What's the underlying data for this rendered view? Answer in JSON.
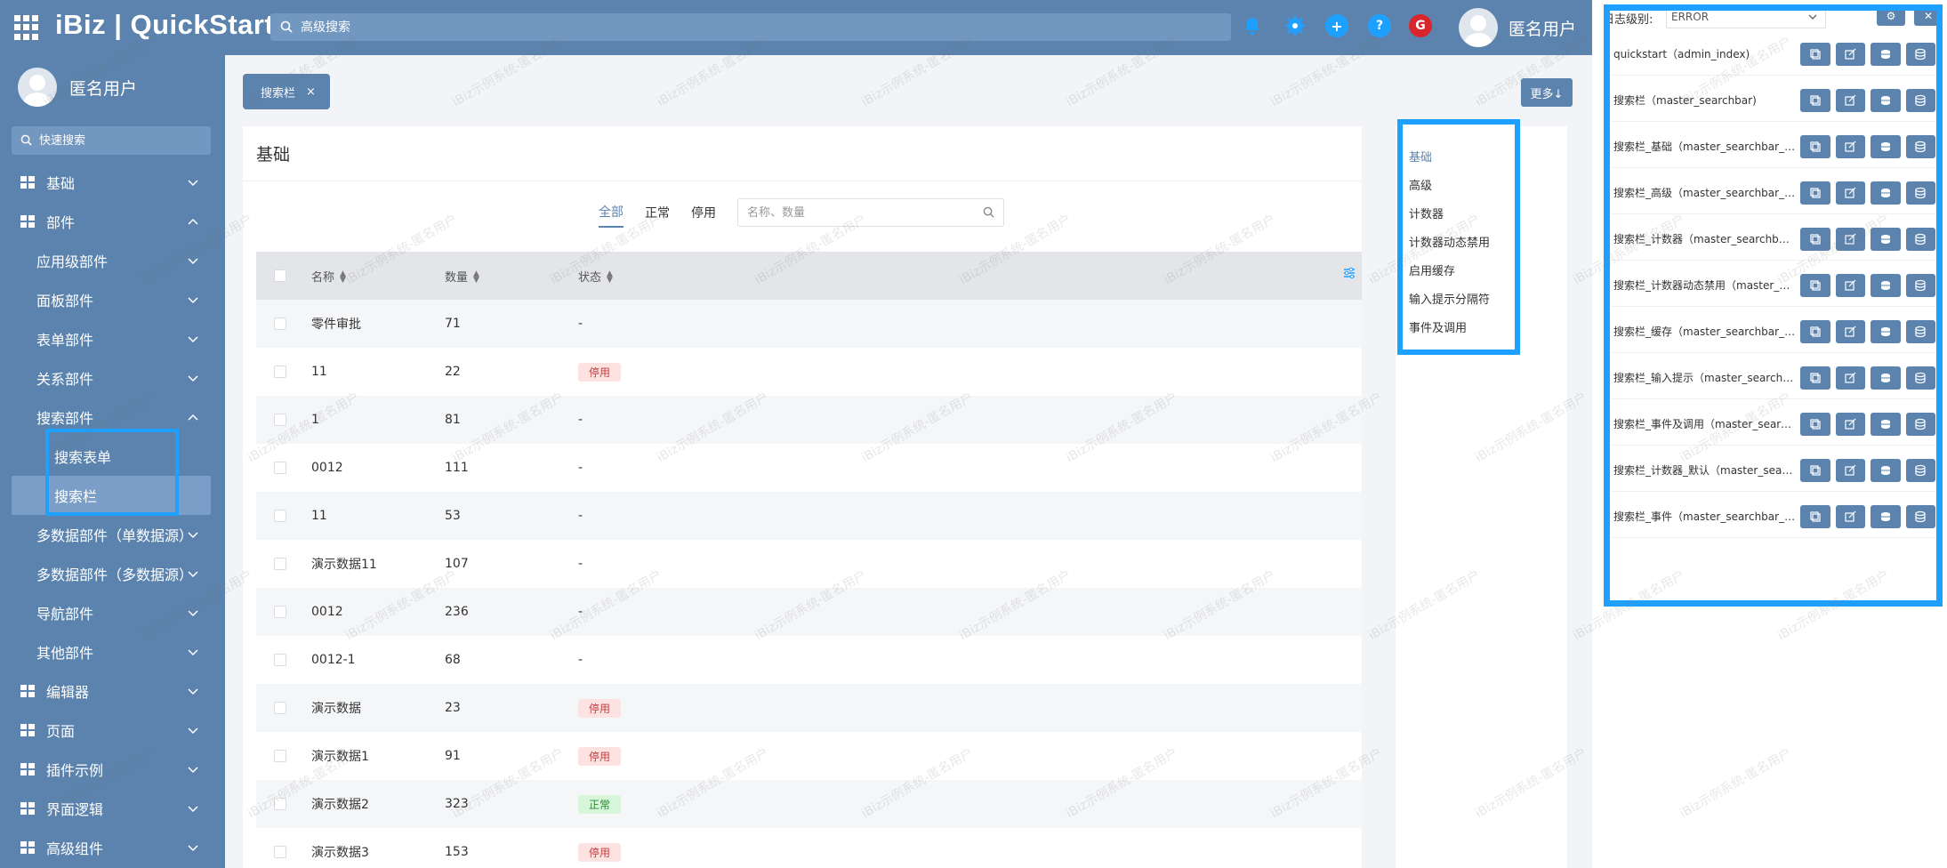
{
  "header": {
    "logo": "iBiz | QuickStart",
    "search_placeholder": "高级搜索",
    "icons": [
      "bell-icon",
      "gear-icon",
      "plus-icon",
      "help-icon",
      "brand-g-icon"
    ],
    "user_name": "匿名用户"
  },
  "sidebar": {
    "user_name": "匿名用户",
    "search_placeholder": "快速搜索",
    "items": [
      {
        "label": "基础",
        "level": 1,
        "expanded": false
      },
      {
        "label": "部件",
        "level": 1,
        "expanded": true
      },
      {
        "label": "应用级部件",
        "level": 2,
        "expanded": false
      },
      {
        "label": "面板部件",
        "level": 2,
        "expanded": false
      },
      {
        "label": "表单部件",
        "level": 2,
        "expanded": false
      },
      {
        "label": "关系部件",
        "level": 2,
        "expanded": false
      },
      {
        "label": "搜索部件",
        "level": 2,
        "expanded": true
      },
      {
        "label": "搜索表单",
        "level": 3
      },
      {
        "label": "搜索栏",
        "level": 3,
        "selected": true
      },
      {
        "label": "多数据部件（单数据源）",
        "level": 2,
        "expanded": false
      },
      {
        "label": "多数据部件（多数据源）",
        "level": 2,
        "expanded": false
      },
      {
        "label": "导航部件",
        "level": 2,
        "expanded": false
      },
      {
        "label": "其他部件",
        "level": 2,
        "expanded": false
      },
      {
        "label": "编辑器",
        "level": 1,
        "expanded": false
      },
      {
        "label": "页面",
        "level": 1,
        "expanded": false
      },
      {
        "label": "插件示例",
        "level": 1,
        "expanded": false
      },
      {
        "label": "界面逻辑",
        "level": 1,
        "expanded": false
      },
      {
        "label": "高级组件",
        "level": 1,
        "expanded": false
      }
    ]
  },
  "tabs": [
    {
      "label": "搜索栏",
      "close": "×"
    }
  ],
  "more_button": "更多↓",
  "card": {
    "title": "基础",
    "filters": [
      "全部",
      "正常",
      "停用"
    ],
    "active_filter": 0,
    "search_placeholder": "名称、数量",
    "columns": [
      "名称",
      "数量",
      "状态"
    ],
    "rows": [
      {
        "name": "零件审批",
        "qty": "71",
        "status": "-",
        "status_type": "none"
      },
      {
        "name": "11",
        "qty": "22",
        "status": "停用",
        "status_type": "off"
      },
      {
        "name": "1",
        "qty": "81",
        "status": "-",
        "status_type": "none"
      },
      {
        "name": "0012",
        "qty": "111",
        "status": "-",
        "status_type": "none"
      },
      {
        "name": "11",
        "qty": "53",
        "status": "-",
        "status_type": "none"
      },
      {
        "name": "演示数据11",
        "qty": "107",
        "status": "-",
        "status_type": "none"
      },
      {
        "name": "0012",
        "qty": "236",
        "status": "-",
        "status_type": "none"
      },
      {
        "name": "0012-1",
        "qty": "68",
        "status": "-",
        "status_type": "none"
      },
      {
        "name": "演示数据",
        "qty": "23",
        "status": "停用",
        "status_type": "off"
      },
      {
        "name": "演示数据1",
        "qty": "91",
        "status": "停用",
        "status_type": "off"
      },
      {
        "name": "演示数据2",
        "qty": "323",
        "status": "正常",
        "status_type": "on"
      },
      {
        "name": "演示数据3",
        "qty": "153",
        "status": "停用",
        "status_type": "off"
      }
    ]
  },
  "anchors": [
    "基础",
    "高级",
    "计数器",
    "计数器动态禁用",
    "启用缓存",
    "输入提示分隔符",
    "事件及调用"
  ],
  "active_anchor": 0,
  "debug": {
    "log_label": "日志级别:",
    "log_level": "ERROR",
    "entries": [
      "quickstart（admin_index)",
      "搜索栏（master_searchbar)",
      "搜索栏_基础（master_searchbar_b...",
      "搜索栏_高级（master_searchbar_hi...",
      "搜索栏_计数器（master_searchbar_...",
      "搜索栏_计数器动态禁用（master_se...",
      "搜索栏_缓存（master_searchbar_st...",
      "搜索栏_输入提示（master_searchb...",
      "搜索栏_事件及调用（master_search...",
      "搜索栏_计数器_默认（master_searc...",
      "搜索栏_事件（master_searchbar_lo..."
    ]
  },
  "watermark": "iBiz示例系统-匿名用户",
  "colors": {
    "primary": "#5b83ae",
    "highlight": "#1ea0ff",
    "disabled_badge": "#fde2e2",
    "normal_badge": "#d7f5d9"
  }
}
